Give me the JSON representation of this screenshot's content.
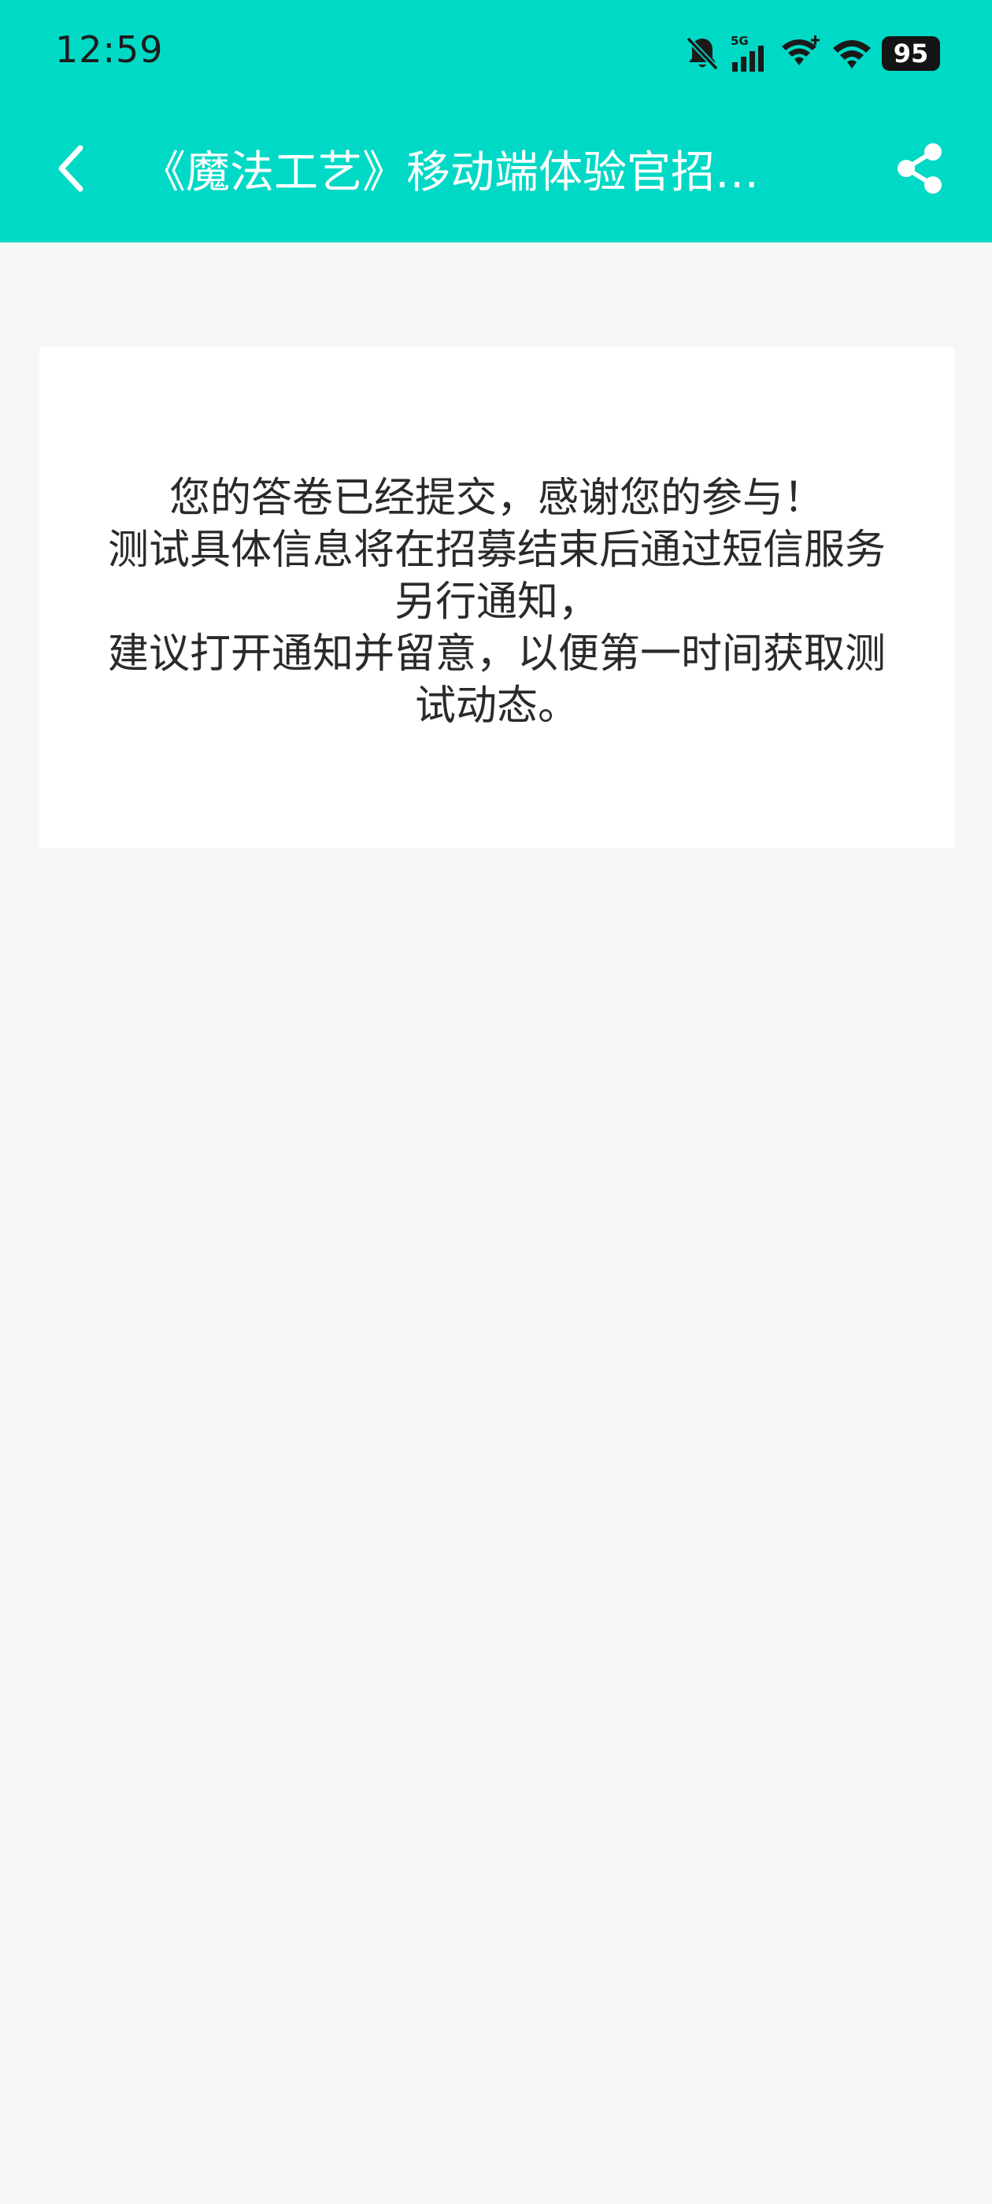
{
  "status_bar": {
    "time": "12:59",
    "network_label": "5G",
    "battery": "95",
    "icons": [
      "bell-muted-icon",
      "cellular-5g-icon",
      "wifi-plus-icon",
      "wifi-icon",
      "battery-icon"
    ]
  },
  "toolbar": {
    "title": "《魔法工艺》移动端体验官招…",
    "back_icon": "chevron-left-icon",
    "share_icon": "share-icon"
  },
  "card": {
    "lines": [
      "您的答卷已经提交，感谢您的参与！",
      "测试具体信息将在招募结束后通过短信服务另行通知，",
      "建议打开通知并留意，以便第一时间获取测试动态。"
    ]
  },
  "colors": {
    "header": "#00d9c5",
    "background": "#f6f6f6",
    "card": "#ffffff",
    "text": "#2a2a2a"
  }
}
